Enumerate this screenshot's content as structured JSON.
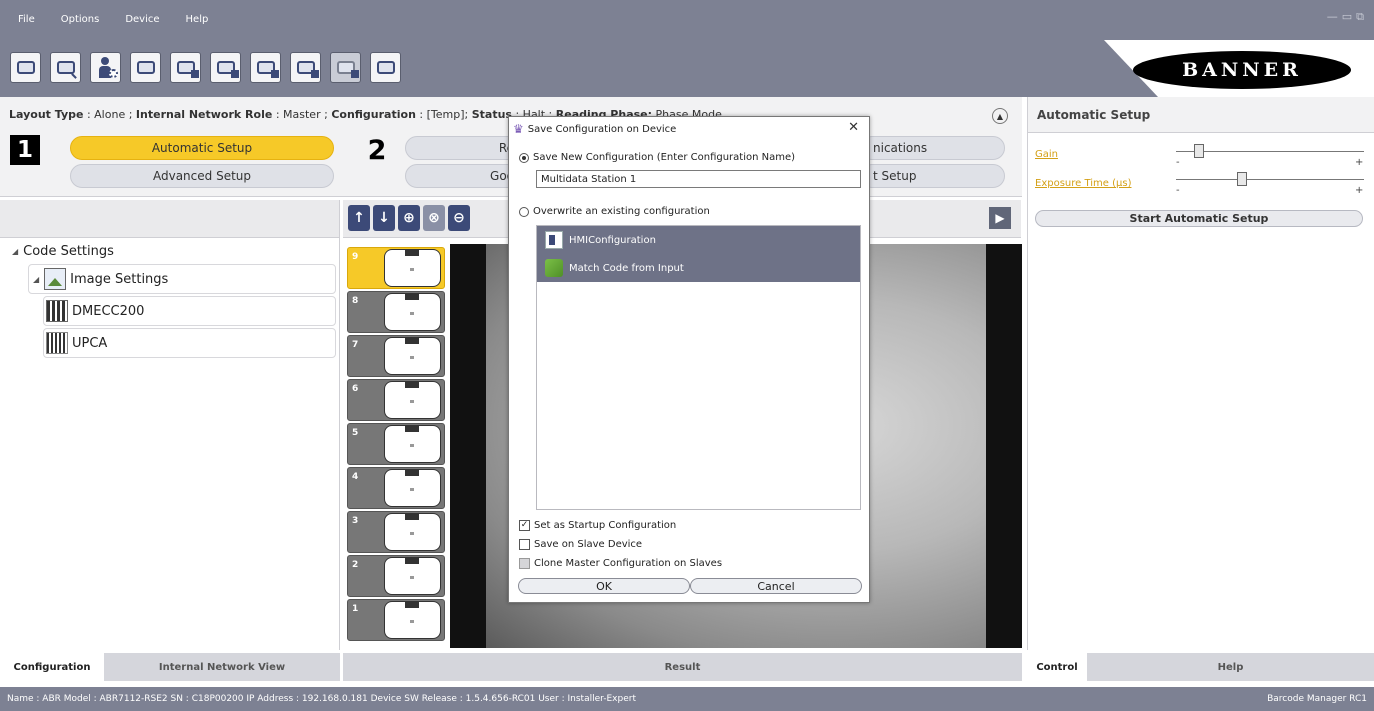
{
  "menu": [
    "File",
    "Options",
    "Device",
    "Help"
  ],
  "window_controls": [
    "—",
    "▭",
    "⧉"
  ],
  "brand": "BANNER",
  "toolbar": [
    {
      "icon": "device-icon"
    },
    {
      "icon": "search-device-icon"
    },
    {
      "icon": "user-settings-icon"
    },
    {
      "icon": "window-icon"
    },
    {
      "icon": "send-config-icon"
    },
    {
      "icon": "save-config-icon"
    },
    {
      "icon": "load-config-icon"
    },
    {
      "icon": "export-config-icon"
    },
    {
      "icon": "disabled-config-icon"
    },
    {
      "icon": "network-icon"
    }
  ],
  "info": {
    "layout_type_label": "Layout Type",
    "layout_type": "Alone",
    "network_role_label": "Internal Network Role",
    "network_role": "Master",
    "configuration_label": "Configuration",
    "configuration": "[Temp]",
    "status_label": "Status",
    "status": "Halt",
    "reading_phase_label": "Reading Phase:",
    "reading_phase": "Phase Mode"
  },
  "steps": {
    "step1_num": "1",
    "step2_num": "2",
    "automatic_setup": "Automatic Setup",
    "advanced_setup": "Advanced Setup",
    "reading": "Re",
    "good": "Goo",
    "communications": "nications",
    "output_setup": "t Setup"
  },
  "tree": {
    "code_settings": "Code Settings",
    "image_settings": "Image Settings",
    "dmecc200": "DMECC200",
    "upca": "UPCA"
  },
  "thumbnails": [
    "9",
    "8",
    "7",
    "6",
    "5",
    "4",
    "3",
    "2",
    "1"
  ],
  "right": {
    "title": "Automatic Setup",
    "gain_label": "Gain",
    "exposure_label": "Exposure Time (µs)",
    "minus": "-",
    "plus": "+",
    "gain_level": 0.12,
    "exposure_level": 0.35,
    "start_button": "Start Automatic Setup"
  },
  "tabs": {
    "configuration": "Configuration",
    "internal_network_view": "Internal Network View",
    "result": "Result",
    "control": "Control",
    "help": "Help"
  },
  "status_bar": {
    "left": "Name : ABR  Model : ABR7112-RSE2  SN : C18P00200  IP Address : 192.168.0.181  Device SW Release : 1.5.4.656-RC01  User : Installer-Expert",
    "right": "Barcode Manager RC1"
  },
  "dialog": {
    "title": "Save Configuration on Device",
    "close": "✕",
    "save_new_label": "Save New Configuration (Enter Configuration Name)",
    "config_name": "Multidata Station 1",
    "overwrite_label": "Overwrite an existing configuration",
    "existing": [
      "HMIConfiguration",
      "Match Code from Input"
    ],
    "set_startup": "Set as Startup Configuration",
    "save_slave": "Save on Slave Device",
    "clone_master": "Clone Master Configuration on Slaves",
    "ok": "OK",
    "cancel": "Cancel",
    "check_mark": "✓"
  }
}
